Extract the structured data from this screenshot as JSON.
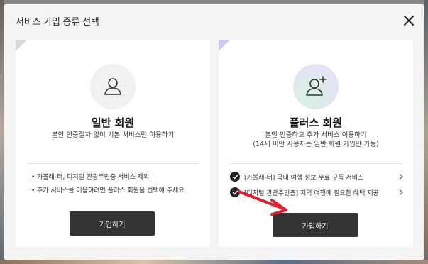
{
  "modal": {
    "title": "서비스 가입 종류 선택"
  },
  "cards": {
    "general": {
      "title": "일반 회원",
      "description": "본인 인증절차 없이 기본 서비스만 이용하기",
      "notes": [
        "가볼래-터, 디지털 관광주민증 서비스 제외",
        "추가 서비스를 이용하려면 플러스 회원을 선택해 주세요."
      ],
      "button": "가입하기"
    },
    "plus": {
      "title": "플러스 회원",
      "description_line1": "본인 인증하고 추가 서비스 이용하기",
      "description_line2": "(14세 미만 사용자는 일반 회원 가입만 가능)",
      "benefits": [
        "[가볼래-터] 국내 여행 정보 무료 구독 서비스",
        "[디지털 관광주민증] 지역 여행에 필요한 혜택 제공"
      ],
      "button": "가입하기"
    }
  },
  "icons": {
    "close": "close-icon",
    "general_avatar": "user-icon",
    "plus_avatar": "user-plus-icon",
    "benefit_check": "check-circle-icon",
    "benefit_link": "chevron-right-icon",
    "annotation": "red-arrow"
  },
  "colors": {
    "button_bg": "#333333",
    "annotation_arrow": "#e0202e",
    "plus_accent": "#cdc9f0"
  }
}
